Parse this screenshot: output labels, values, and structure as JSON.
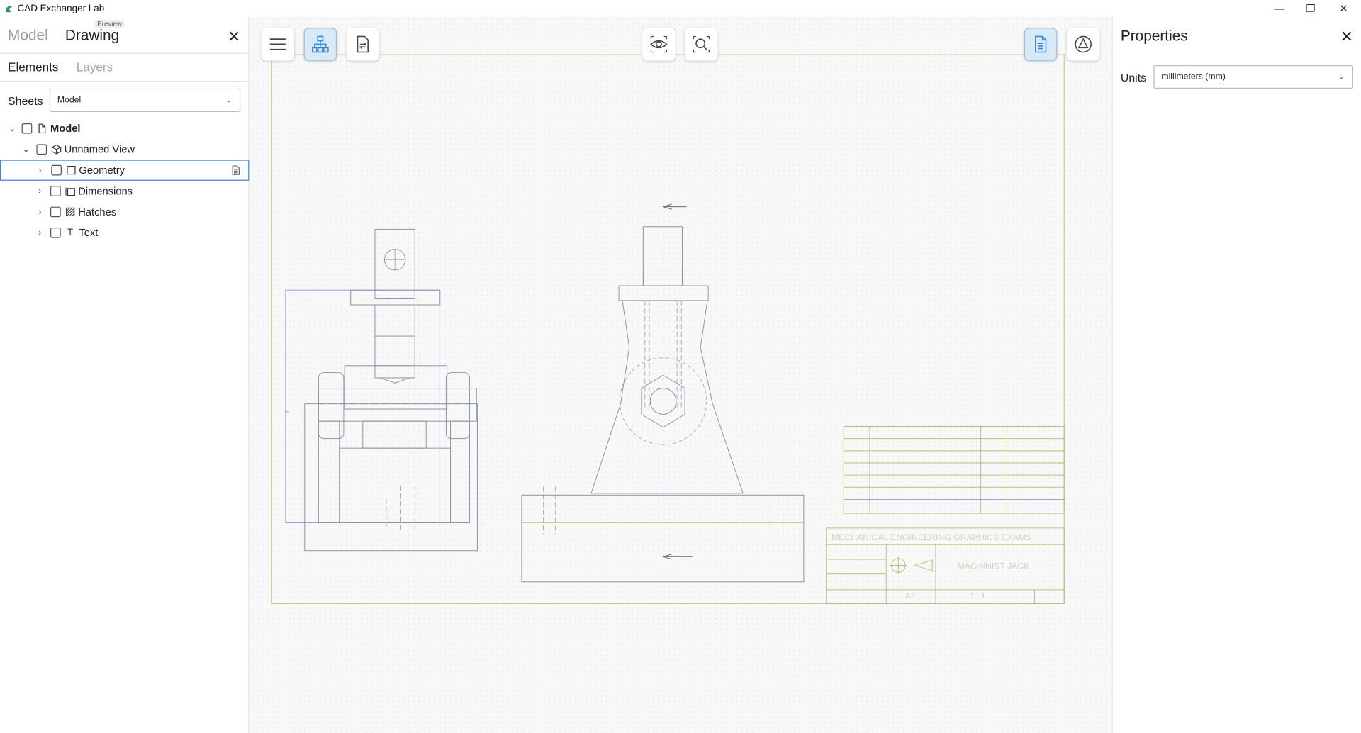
{
  "window": {
    "title": "CAD Exchanger Lab",
    "minimize_glyph": "—",
    "restore_glyph": "❐",
    "close_glyph": "✕"
  },
  "left_panel": {
    "mode_tabs": {
      "model": "Model",
      "drawing": "Drawing",
      "badge": "Preview",
      "active": "Drawing"
    },
    "close_glyph": "✕",
    "sub_tabs": {
      "elements": "Elements",
      "layers": "Layers",
      "active": "Elements"
    },
    "sheets": {
      "label": "Sheets",
      "value": "Model"
    },
    "tree": [
      {
        "label": "Model",
        "bold": true,
        "expanded": true,
        "icon": "page-icon",
        "level": 0
      },
      {
        "label": "Unnamed View",
        "expanded": true,
        "icon": "cube-icon",
        "level": 1
      },
      {
        "label": "Geometry",
        "expanded": false,
        "icon": "square-frame-icon",
        "level": 2,
        "selected": true
      },
      {
        "label": "Dimensions",
        "expanded": false,
        "icon": "dimensions-icon",
        "level": 2
      },
      {
        "label": "Hatches",
        "expanded": false,
        "icon": "hatch-icon",
        "level": 2
      },
      {
        "label": "Text",
        "expanded": false,
        "icon": "text-icon",
        "level": 2,
        "icon_glyph": "T"
      }
    ]
  },
  "toolbar": {
    "left": [
      "menu-icon",
      "structure-tree-icon",
      "sheet-swap-icon"
    ],
    "center": [
      "eye-icon",
      "zoom-fit-icon"
    ],
    "right": [
      "document-icon",
      "measure-icon"
    ],
    "active": [
      "structure-tree-icon",
      "document-icon"
    ]
  },
  "drawing": {
    "title_block": {
      "header": "MECHANICAL ENGINEERING GRAPHICS EXAMS",
      "part_name": "MACHINIST JACK",
      "sheet_size": "A3",
      "scale": "1 : 1"
    }
  },
  "right_panel": {
    "title": "Properties",
    "close_glyph": "✕",
    "units": {
      "label": "Units",
      "value": "millimeters (mm)"
    }
  },
  "colors": {
    "accent": "#3a86d6",
    "active_button_bg": "#d9e9f6",
    "drawing_line": "#7b8fbf",
    "sheet_border": "#c7cf8c"
  }
}
